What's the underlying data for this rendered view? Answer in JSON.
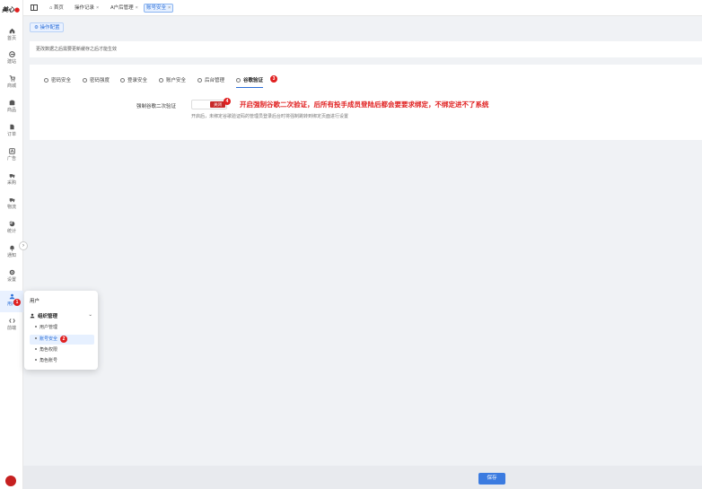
{
  "logo": {
    "text": "美心",
    "mark": "●"
  },
  "sidebar": {
    "items": [
      {
        "label": "首页",
        "icon": "home-icon"
      },
      {
        "label": "建站",
        "icon": "site-icon"
      },
      {
        "label": "商城",
        "icon": "cart-icon"
      },
      {
        "label": "商品",
        "icon": "box-icon"
      },
      {
        "label": "订单",
        "icon": "order-icon"
      },
      {
        "label": "广告",
        "icon": "ad-icon"
      },
      {
        "label": "采购",
        "icon": "truck-icon"
      },
      {
        "label": "物流",
        "icon": "truck-icon"
      },
      {
        "label": "统计",
        "icon": "pie-chart-icon"
      },
      {
        "label": "通知",
        "icon": "bell-icon"
      },
      {
        "label": "设置",
        "icon": "gear-icon"
      },
      {
        "label": "用户",
        "icon": "user-icon"
      },
      {
        "label": "前端",
        "icon": "code-icon"
      }
    ],
    "user_badge": "1",
    "collapse_glyph": "›"
  },
  "tabs": [
    {
      "label": "⌂ 首页",
      "closable": false
    },
    {
      "label": "操作记录",
      "closable": true
    },
    {
      "label": "A户后管理",
      "closable": true
    },
    {
      "label": "账号安全",
      "closable": true
    }
  ],
  "close_glyph": "×",
  "section_tab": "⚙ 操作配置",
  "hint": "更改数据之后需要更新缓存之后才能生效",
  "subtabs": [
    {
      "label": "密码安全"
    },
    {
      "label": "密码强度"
    },
    {
      "label": "登录安全"
    },
    {
      "label": "账户安全"
    },
    {
      "label": "后台管理"
    },
    {
      "label": "谷歌验证"
    }
  ],
  "subtab_badge": "3",
  "form": {
    "label": "强制谷歌二次验证",
    "toggle_text": "关闭",
    "toggle_badge": "4",
    "annotation": "开启强制谷歌二次验证，后所有投手成员登陆后都会要要求绑定，不绑定进不了系统",
    "help": "开启后，未绑定谷歌验证码的管理员登录后台时将强制跳转到绑定页面进行设置"
  },
  "save_label": "保存",
  "flyout": {
    "title": "用户",
    "group": "组织管理",
    "chevron": "⌄",
    "items": [
      {
        "label": "用户管理"
      },
      {
        "label": "账号安全"
      },
      {
        "label": "角色权限"
      },
      {
        "label": "角色账号"
      }
    ],
    "active_badge": "2"
  },
  "colors": {
    "accent": "#2c6fd8",
    "danger": "#e02020",
    "save": "#3b7be0"
  }
}
